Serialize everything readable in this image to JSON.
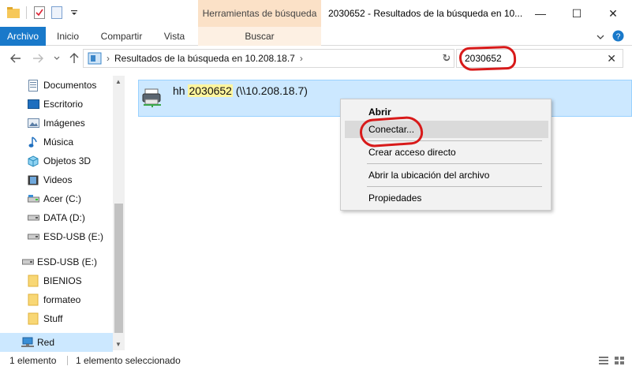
{
  "window": {
    "title": "2030652 - Resultados de la búsqueda en 10...",
    "minimize": "—",
    "maximize": "☐",
    "close": "✕"
  },
  "ribbon": {
    "context_group": "Herramientas de búsqueda",
    "tabs": [
      "Archivo",
      "Inicio",
      "Compartir",
      "Vista",
      "Buscar"
    ],
    "expand_icon": "chevron-down-icon",
    "help_icon": "help-icon"
  },
  "address": {
    "path": "Resultados de la búsqueda en 10.208.18.7",
    "separator": "›",
    "dropdown": "⌄",
    "refresh": "↻"
  },
  "search": {
    "value": "2030652",
    "clear": "✕"
  },
  "sidebar": {
    "items": [
      {
        "label": "Documentos",
        "icon": "documents-icon"
      },
      {
        "label": "Escritorio",
        "icon": "desktop-icon"
      },
      {
        "label": "Imágenes",
        "icon": "pictures-icon"
      },
      {
        "label": "Música",
        "icon": "music-icon"
      },
      {
        "label": "Objetos 3D",
        "icon": "3d-objects-icon"
      },
      {
        "label": "Videos",
        "icon": "videos-icon"
      },
      {
        "label": "Acer (C:)",
        "icon": "drive-icon"
      },
      {
        "label": "DATA (D:)",
        "icon": "drive-icon"
      },
      {
        "label": "ESD-USB (E:)",
        "icon": "usb-drive-icon"
      },
      {
        "label": "ESD-USB (E:)",
        "icon": "usb-drive-icon"
      },
      {
        "label": "BIENIOS",
        "icon": "folder-icon"
      },
      {
        "label": "formateo",
        "icon": "folder-icon"
      },
      {
        "label": "Stuff",
        "icon": "folder-icon"
      },
      {
        "label": "Red",
        "icon": "network-icon"
      }
    ]
  },
  "result": {
    "prefix": "hh ",
    "match": "2030652",
    "suffix": " (\\\\10.208.18.7)",
    "icon": "network-printer-icon"
  },
  "context_menu": {
    "items": [
      "Abrir",
      "Conectar...",
      "Crear acceso directo",
      "Abrir la ubicación del archivo",
      "Propiedades"
    ]
  },
  "status": {
    "count": "1 elemento",
    "selected": "1 elemento seleccionado"
  },
  "colors": {
    "file_tab": "#1979ca",
    "context_tab": "#fbe1c7",
    "selection": "#cce8ff",
    "search_highlight": "#fff59d",
    "annotation_red": "#d81a1a"
  }
}
